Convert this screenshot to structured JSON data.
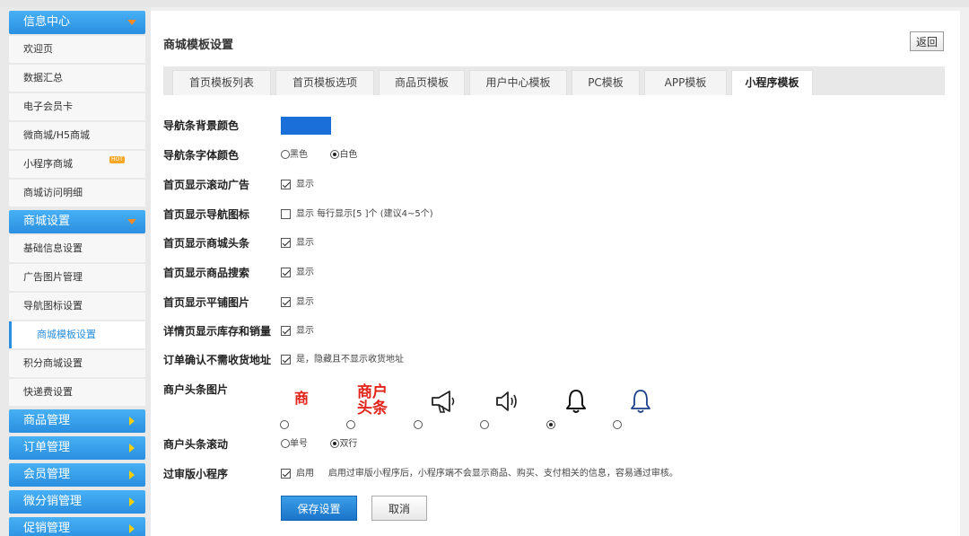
{
  "sidebar": {
    "groups": [
      {
        "title": "信息中心",
        "items": [
          "欢迎页",
          "数据汇总",
          "电子会员卡",
          "微商城/H5商城",
          "小程序商城",
          "商城访问明细"
        ]
      },
      {
        "title": "商城设置",
        "items": [
          "基础信息设置",
          "广告图片管理",
          "导航图标设置",
          "商城模板设置",
          "积分商城设置",
          "快递费设置"
        ]
      }
    ],
    "hot_badge": "HOT",
    "collapsed": [
      "商品管理",
      "订单管理",
      "会员管理",
      "微分销管理",
      "促销管理"
    ]
  },
  "main": {
    "title": "商城模板设置",
    "back_label": "返回",
    "tabs": [
      "首页模板列表",
      "首页模板选项",
      "商品页模板",
      "用户中心模板",
      "PC模板",
      "APP模板",
      "小程序模板"
    ],
    "active_tab": "小程序模板",
    "nav_bg_color": "#1b6fd8",
    "form": {
      "nav_bg_label": "导航条背景颜色",
      "nav_font_label": "导航条字体颜色",
      "nav_font_black": "黑色",
      "nav_font_white": "白色",
      "scroll_ad_label": "首页显示滚动广告",
      "nav_icon_label": "首页显示导航图标",
      "nav_icon_text": "显示 每行显示[5   ]个   (建议4~5个)",
      "headline_label": "首页显示商城头条",
      "search_label": "首页显示商品搜索",
      "tile_label": "首页显示平铺图片",
      "stock_label": "详情页显示库存和销量",
      "no_addr_label": "订单确认不需收货地址",
      "no_addr_text": "是，隐藏且不显示收货地址",
      "show_text": "显示",
      "headline_img_label": "商户头条图片",
      "img_char_1": "商",
      "img_text_2a": "商户",
      "img_text_2b": "头条",
      "headline_scroll_label": "商户头条滚动",
      "single_row": "单号",
      "double_row": "双行",
      "review_label": "过审版小程序",
      "review_enable": "启用",
      "review_desc": "启用过审版小程序后，小程序端不会显示商品、购买、支付相关的信息，容易通过审核。",
      "save_label": "保存设置",
      "cancel_label": "取消"
    }
  }
}
